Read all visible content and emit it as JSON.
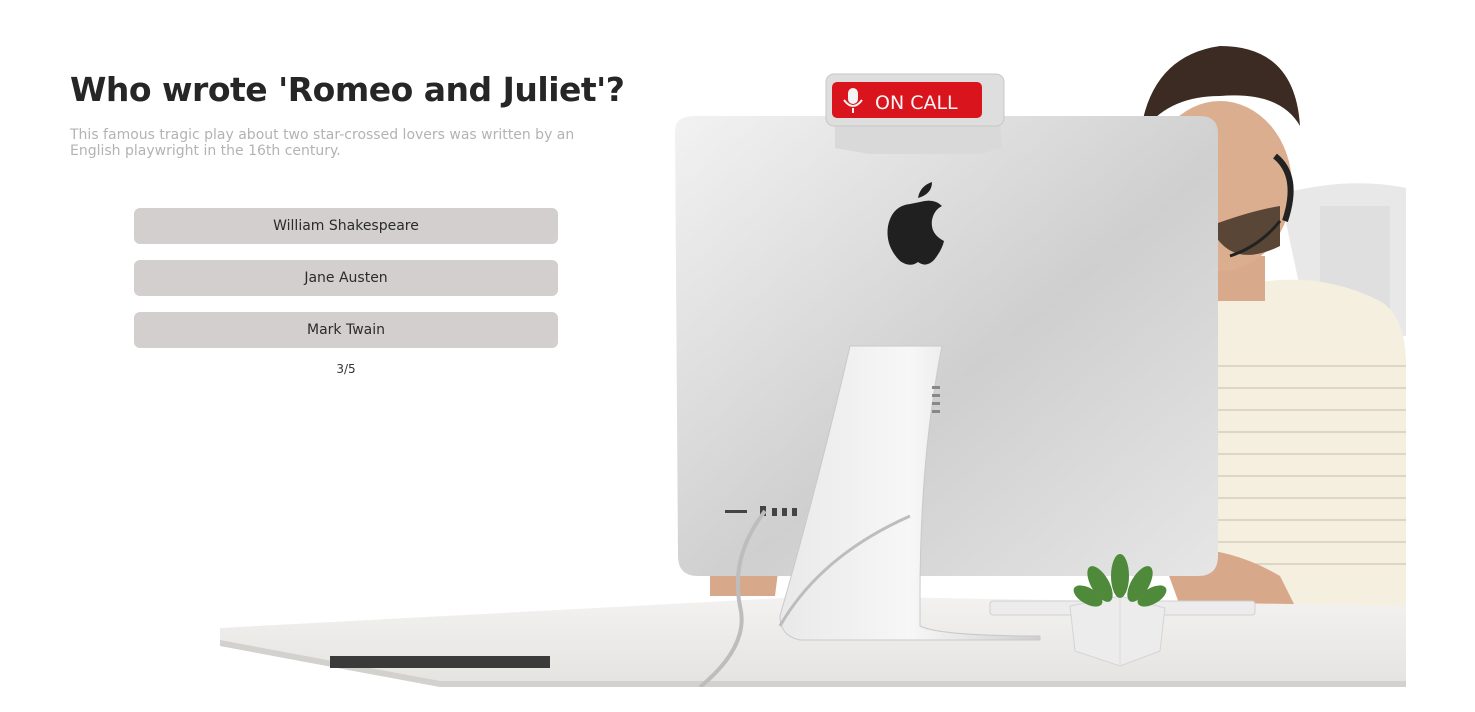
{
  "quiz": {
    "question": "Who wrote 'Romeo and Juliet'?",
    "description": "This famous tragic play about two star-crossed lovers was written by an English playwright in the 16th century.",
    "answers": [
      {
        "label": "William Shakespeare"
      },
      {
        "label": "Jane Austen"
      },
      {
        "label": "Mark Twain"
      }
    ],
    "progress": "3/5"
  },
  "photo": {
    "sign_text": "ON CALL",
    "sign_icon": "microphone-icon",
    "logo_icon": "apple-logo-icon"
  },
  "colors": {
    "answer_bg": "#d3cfcf",
    "question_text": "#262626",
    "description_text": "#b3b3b3",
    "sign_red": "#d9141c"
  }
}
